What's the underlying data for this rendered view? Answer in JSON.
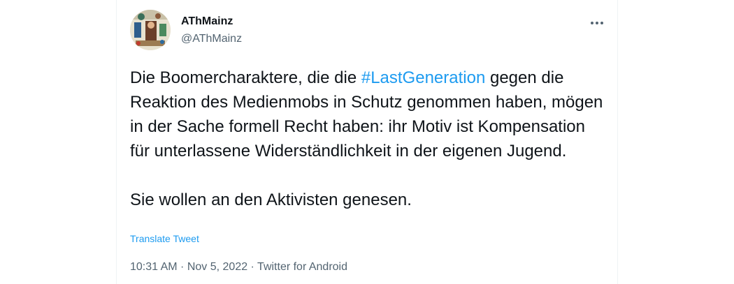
{
  "author": {
    "display_name": "AThMainz",
    "handle": "@AThMainz"
  },
  "icons": {
    "avatar": "avatar-image",
    "more": "more-options-icon"
  },
  "tweet": {
    "line_before_hashtag": "Die Boomercharaktere, die die ",
    "hashtag": "#LastGeneration",
    "line_after_hashtag": " gegen die Reaktion des Medienmobs in Schutz genommen haben, mögen in der Sache formell Recht haben: ihr Motiv ist Kompensation für unterlassene Widerständlichkeit in der eigenen Jugend.",
    "paragraph_2": "Sie wollen an den Aktivisten genesen."
  },
  "translate_label": "Translate Tweet",
  "meta": {
    "time": "10:31 AM",
    "separator": " · ",
    "date": "Nov 5, 2022",
    "source": "Twitter for Android"
  },
  "colors": {
    "link": "#1d9bf0",
    "text": "#0f1419",
    "secondary": "#536471"
  }
}
